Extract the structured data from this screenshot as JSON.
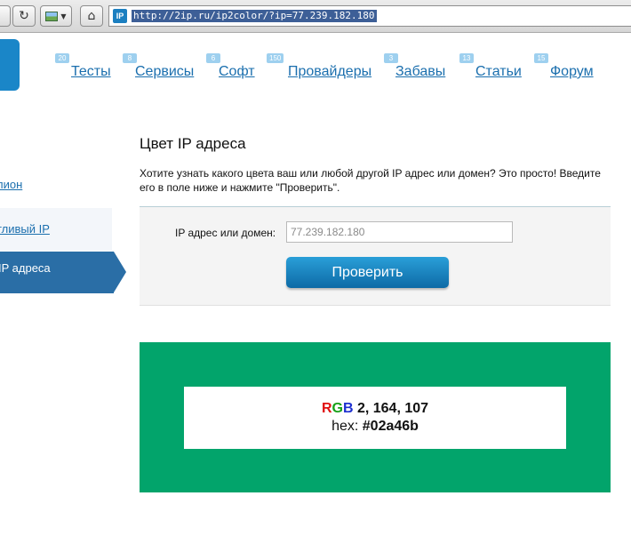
{
  "browser": {
    "url": "http://2ip.ru/ip2color/?ip=77.239.182.180",
    "site_icon_text": "IP"
  },
  "nav": [
    {
      "badge": "20",
      "label": "Тесты"
    },
    {
      "badge": "8",
      "label": "Сервисы"
    },
    {
      "badge": "6",
      "label": "Софт"
    },
    {
      "badge": "150",
      "label": "Провайдеры"
    },
    {
      "badge": "3",
      "label": "Забавы"
    },
    {
      "badge": "13",
      "label": "Статьи"
    },
    {
      "badge": "15",
      "label": "Форум"
    }
  ],
  "sidebar": {
    "items": [
      {
        "label": "лион"
      },
      {
        "label": "тливый IP"
      },
      {
        "label": "IP адреса"
      }
    ]
  },
  "main": {
    "title": "Цвет IP адреса",
    "intro": "Хотите узнать какого цвета ваш или любой другой IP адрес или домен? Это просто! Введите его в поле ниже и нажмите \"Проверить\".",
    "form": {
      "label": "IP адрес или домен:",
      "value": "77.239.182.180",
      "button": "Проверить"
    },
    "result": {
      "r_letter": "R",
      "g_letter": "G",
      "b_letter": "B",
      "rgb_value": "2, 164, 107",
      "hex_label": "hex:",
      "hex_value": "#02a46b",
      "color": "#02a46b"
    }
  },
  "colors": {
    "accent": "#1b6fae",
    "active": "#2a6ea6"
  }
}
